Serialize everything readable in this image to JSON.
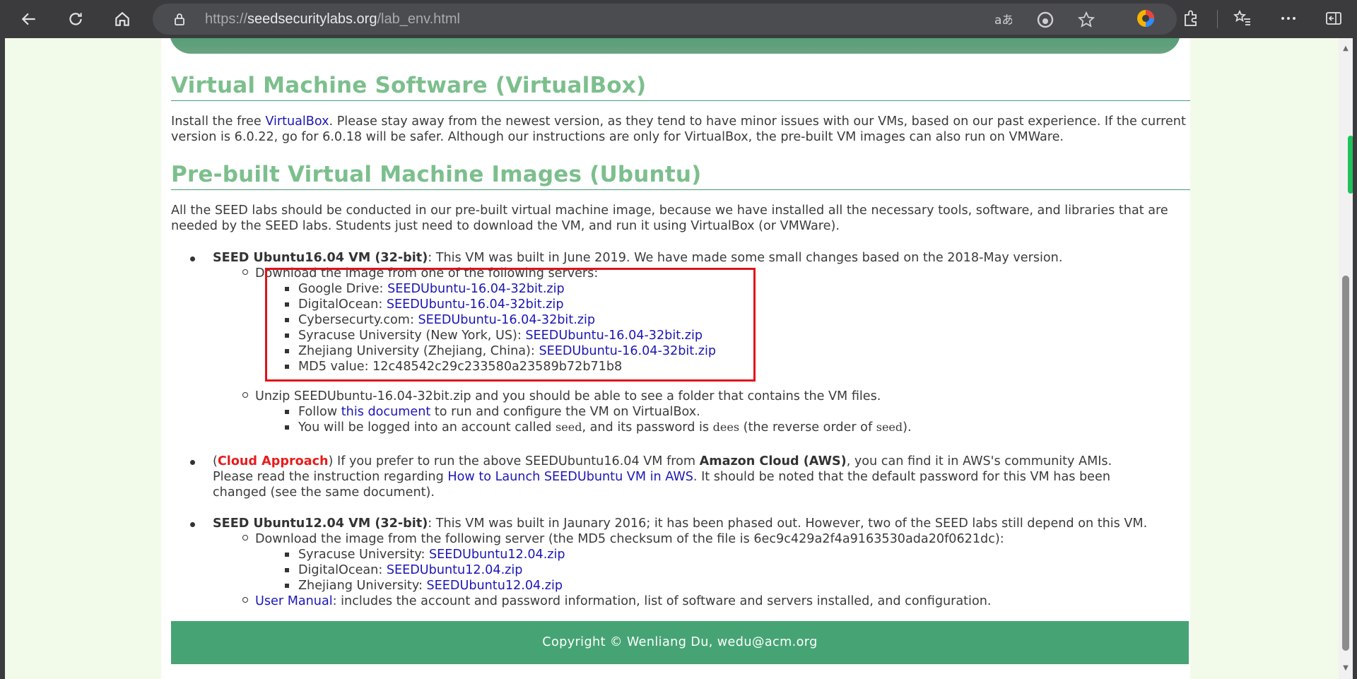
{
  "browser": {
    "url_prefix": "https://",
    "url_domain": "seedsecuritylabs.org",
    "url_path": "/lab_env.html"
  },
  "sections": {
    "vbox_title": "Virtual Machine Software (VirtualBox)",
    "vbox_p1": "Install the free ",
    "vbox_link": "VirtualBox",
    "vbox_p2": ". Please stay away from the newest version, as they tend to have minor issues with our VMs, based on our past experience. If the current version is 6.0.22, go for 6.0.18 will be safer. Although our instructions are only for VirtualBox, the pre-built VM images can also run on VMWare.",
    "images_title": "Pre-built Virtual Machine Images (Ubuntu)",
    "images_p": "All the SEED labs should be conducted in our pre-built virtual machine image, because we have installed all the necessary tools, software, and libraries that are needed by the SEED labs. Students just need to download the VM, and run it using VirtualBox (or VMWare)."
  },
  "vm16": {
    "title": "SEED Ubuntu16.04 VM (32-bit)",
    "desc": ": This VM was built in June 2019. We have made some small changes based on the 2018-May version.",
    "download_label": "Download the image from one of the following servers:",
    "servers": [
      {
        "label": "Google Drive: ",
        "link": "SEEDUbuntu-16.04-32bit.zip"
      },
      {
        "label": "DigitalOcean: ",
        "link": "SEEDUbuntu-16.04-32bit.zip"
      },
      {
        "label": "Cybersecurty.com: ",
        "link": "SEEDUbuntu-16.04-32bit.zip"
      },
      {
        "label": "Syracuse University (New York, US): ",
        "link": "SEEDUbuntu-16.04-32bit.zip"
      },
      {
        "label": "Zhejiang University (Zhejiang, China): ",
        "link": "SEEDUbuntu-16.04-32bit.zip"
      }
    ],
    "md5": "MD5 value: 12c48542c29c233580a23589b72b71b8",
    "unzip": "Unzip SEEDUbuntu-16.04-32bit.zip and you should be able to see a folder that contains the VM files.",
    "follow_pre": "Follow ",
    "follow_link": "this document",
    "follow_post": " to run and configure the VM on VirtualBox.",
    "login_pre": "You will be logged into an account called ",
    "login_user": "seed",
    "login_mid": ", and its password is ",
    "login_pass": "dees",
    "login_rev": " (the reverse order of ",
    "login_seed2": "seed",
    "login_end": ")."
  },
  "cloud": {
    "open": "(",
    "tag": "Cloud Approach",
    "t1": ") If you prefer to run the above SEEDUbuntu16.04 VM from ",
    "aws": "Amazon Cloud (AWS)",
    "t2": ", you can find it in AWS's community AMIs.",
    "t3": "Please read the instruction regarding ",
    "link": "How to Launch SEEDUbuntu VM in AWS",
    "t4": ". It should be noted that the default password for this VM has been",
    "t5": "changed (see the same document)."
  },
  "vm12": {
    "title": "SEED Ubuntu12.04 VM (32-bit)",
    "desc": ": This VM was built in Jaunary 2016; it has been phased out. However, two of the SEED labs still depend on this VM.",
    "download_label": "Download the image from the following server (the MD5 checksum of the file is 6ec9c429a2f4a9163530ada20f0621dc):",
    "servers": [
      {
        "label": "Syracuse University: ",
        "link": "SEEDUbuntu12.04.zip"
      },
      {
        "label": "DigitalOcean: ",
        "link": "SEEDUbuntu12.04.zip"
      },
      {
        "label": "Zhejiang University: ",
        "link": "SEEDUbuntu12.04.zip"
      }
    ],
    "manual_link": "User Manual",
    "manual_text": ": includes the account and password information, list of software and servers installed, and configuration."
  },
  "footer": "Copyright © Wenliang Du, wedu@acm.org",
  "colors": {
    "heading": "#7cbf8d",
    "footer_bg": "#46a474",
    "link": "#1c17b5",
    "highlight": "#e0121a"
  }
}
